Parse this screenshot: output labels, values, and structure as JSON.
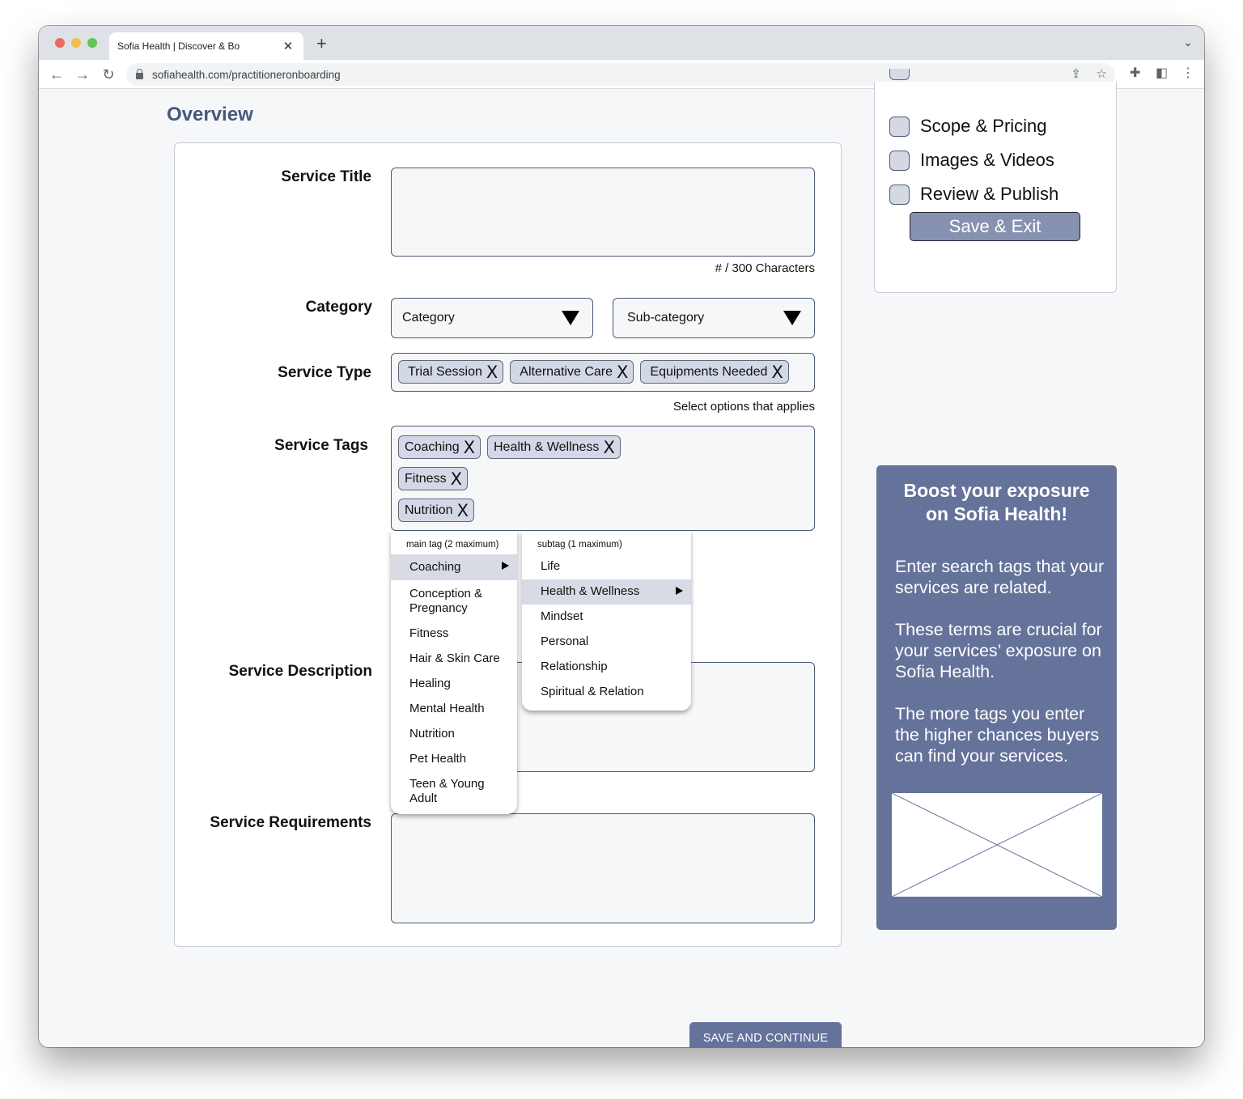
{
  "browser": {
    "tab_title": "Sofia Health | Discover & Bo",
    "url": "sofiahealth.com/practitioneronboarding",
    "icons": {
      "close_tab": "close-icon",
      "new_tab": "plus-icon",
      "tab_menu": "chevron-down-icon",
      "back": "arrow-left-icon",
      "forward": "arrow-right-icon",
      "reload": "reload-icon",
      "lock": "lock-icon",
      "share": "share-icon",
      "bookmark": "star-icon",
      "extensions": "puzzle-icon",
      "side_panel": "side-panel-icon",
      "menu": "kebab-menu-icon"
    },
    "glyphs": {
      "close": "✕",
      "plus": "+",
      "chevron": "⌄",
      "back": "←",
      "forward": "→",
      "reload": "↻",
      "share": "⇪",
      "star": "☆",
      "puzzle": "✚",
      "panel": "◧",
      "kebab": "⋮"
    }
  },
  "page": {
    "section_title": "Overview",
    "form": {
      "service_title": {
        "label": "Service Title",
        "value": "",
        "char_counter": "# / 300 Characters"
      },
      "category": {
        "label": "Category",
        "category_select": "Category",
        "subcategory_select": "Sub-category"
      },
      "service_type": {
        "label": "Service Type",
        "chips": [
          "Trial Session",
          "Alternative Care",
          "Equipments Needed"
        ],
        "helper": "Select options that applies"
      },
      "service_tags": {
        "label": "Service Tags",
        "chips": [
          "Coaching",
          "Health & Wellness",
          "Fitness",
          "Nutrition"
        ],
        "main_menu": {
          "header": "main tag (2 maximum)",
          "items": [
            "Coaching",
            "Conception & Pregnancy",
            "Fitness",
            "Hair & Skin Care",
            "Healing",
            "Mental Health",
            "Nutrition",
            "Pet Health",
            "Teen & Young Adult"
          ],
          "active": "Coaching"
        },
        "sub_menu": {
          "header": "subtag (1 maximum)",
          "items": [
            "Life",
            "Health & Wellness",
            "Mindset",
            "Personal",
            "Relationship",
            "Spiritual & Relation"
          ],
          "active": "Health & Wellness"
        }
      },
      "service_description": {
        "label": "Service Description",
        "value": ""
      },
      "service_requirements": {
        "label": "Service Requirements",
        "value": ""
      },
      "chip_remove_glyph": "X"
    },
    "progress": {
      "steps": [
        {
          "label": "Scope & Pricing",
          "checked": false
        },
        {
          "label": "Images & Videos",
          "checked": false
        },
        {
          "label": "Review & Publish",
          "checked": false
        }
      ],
      "save_exit_label": "Save & Exit"
    },
    "promo": {
      "title": "Boost your exposure on Sofia Health!",
      "paragraphs": [
        "Enter search tags that your services are related.",
        "These terms are crucial for your services’ exposure on Sofia Health.",
        "The more tags you enter the higher chances buyers can find your services."
      ],
      "image": "image-placeholder"
    },
    "save_continue_label": "SAVE AND CONTINUE"
  },
  "colors": {
    "accent": "#65729a",
    "title": "#45597a",
    "chip_bg": "#d3d8e6",
    "page_bg": "#f6f7f9",
    "save_exit_bg": "#8791b0"
  }
}
